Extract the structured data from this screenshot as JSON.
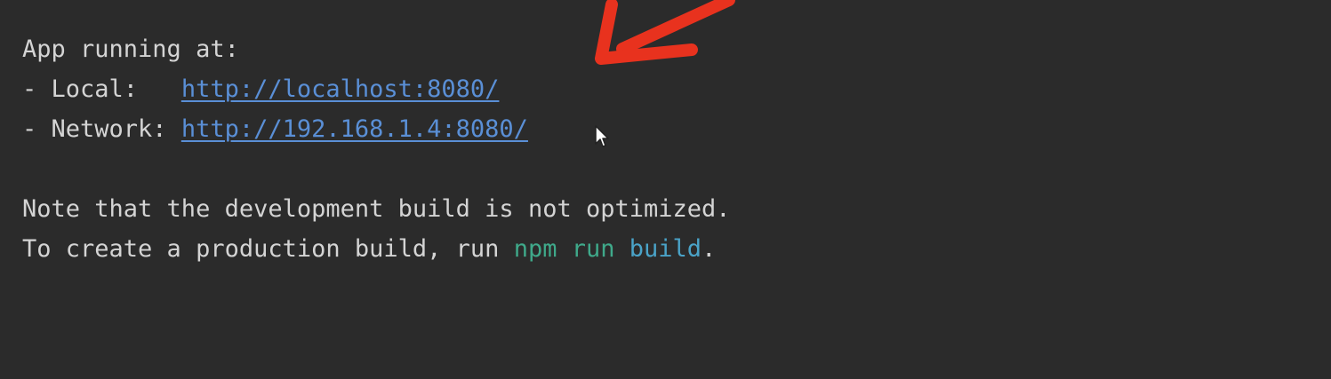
{
  "terminal": {
    "line1": "App running at:",
    "local_prefix": "- Local:   ",
    "local_url": "http://localhost:8080/",
    "network_prefix": "- Network: ",
    "network_url": "http://192.168.1.4:8080/",
    "note_line": "Note that the development build is not optimized.",
    "prod_prefix": "To create a production build, run ",
    "cmd_npm": "npm",
    "cmd_run": "run",
    "cmd_build": "build",
    "prod_suffix": "."
  },
  "icons": {
    "annotation": "red-arrow-icon",
    "pointer": "mouse-cursor-icon"
  },
  "colors": {
    "background": "#2b2b2b",
    "text": "#d4d4d4",
    "link": "#5a8fd6",
    "command_green": "#3fa98a",
    "command_blue": "#4aa3c8",
    "arrow": "#e8321e"
  }
}
